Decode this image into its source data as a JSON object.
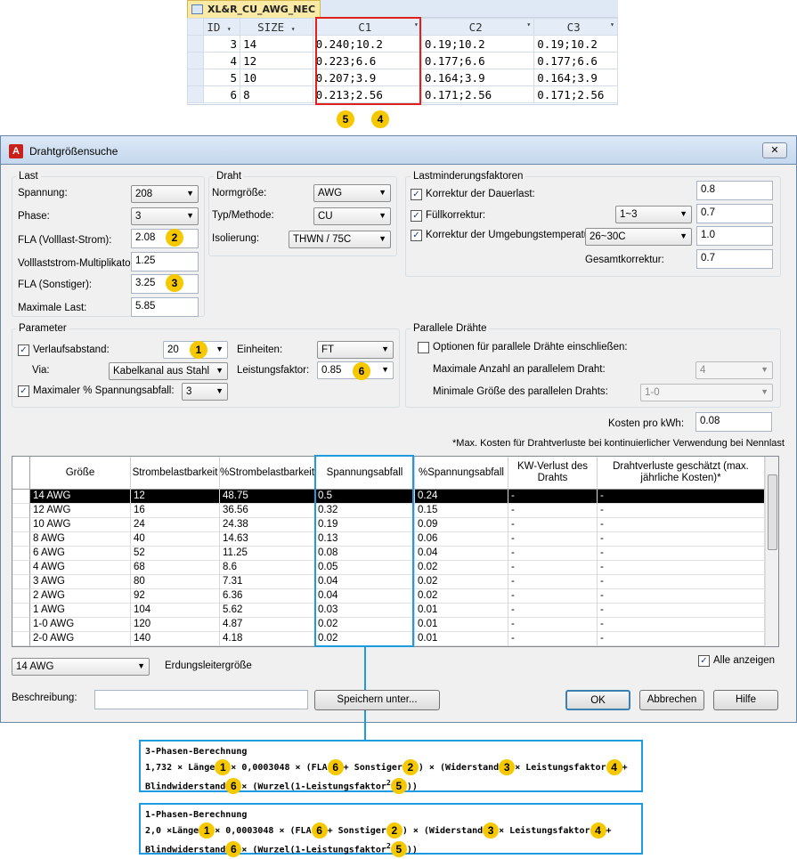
{
  "table": {
    "tab_title": "XL&R_CU_AWG_NEC",
    "columns": [
      "ID",
      "SIZE",
      "C1",
      "C2",
      "C3"
    ],
    "rows": [
      {
        "id": "3",
        "size": "14",
        "c1": "0.240;10.2",
        "c2": "0.19;10.2",
        "c3": "0.19;10.2"
      },
      {
        "id": "4",
        "size": "12",
        "c1": "0.223;6.6",
        "c2": "0.177;6.6",
        "c3": "0.177;6.6"
      },
      {
        "id": "5",
        "size": "10",
        "c1": "0.207;3.9",
        "c2": "0.164;3.9",
        "c3": "0.164;3.9"
      },
      {
        "id": "6",
        "size": "8",
        "c1": "0.213;2.56",
        "c2": "0.171;2.56",
        "c3": "0.171;2.56"
      }
    ],
    "badges": [
      "5",
      "4"
    ]
  },
  "dialog": {
    "title": "Drahtgrößensuche",
    "close": "✕",
    "last": {
      "group": "Last",
      "spannung_label": "Spannung:",
      "spannung": "208",
      "phase_label": "Phase:",
      "phase": "3",
      "fla_label": "FLA (Volllast-Strom):",
      "fla": "2.08",
      "mult_label": "Volllaststrom-Multiplikator:",
      "mult": "1.25",
      "fla_s_label": "FLA (Sonstiger):",
      "fla_s": "3.25",
      "max_label": "Maximale Last:",
      "max": "5.85"
    },
    "draht": {
      "group": "Draht",
      "norm_label": "Normgröße:",
      "norm": "AWG",
      "typ_label": "Typ/Methode:",
      "typ": "CU",
      "iso_label": "Isolierung:",
      "iso": "THWN / 75C"
    },
    "lm": {
      "group": "Lastminderungsfaktoren",
      "dauer_label": "Korrektur der Dauerlast:",
      "dauer": "0.8",
      "full_label": "Füllkorrektur:",
      "full_sel": "1~3",
      "full": "0.7",
      "umg_label": "Korrektur der Umgebungstemperatur:",
      "umg_sel": "26~30C",
      "umg": "1.0",
      "ges_label": "Gesamtkorrektur:",
      "ges": "0.7"
    },
    "param": {
      "group": "Parameter",
      "verl_label": "Verlaufsabstand:",
      "verl": "20",
      "via_label": "Via:",
      "via": "Kabelkanal aus Stahl",
      "max_label": "Maximaler % Spannungsabfall:",
      "max": "3",
      "einh_label": "Einheiten:",
      "einh": "FT",
      "lf_label": "Leistungsfaktor:",
      "lf": "0.85"
    },
    "par": {
      "group": "Parallele Drähte",
      "opt_label": "Optionen für parallele Drähte einschließen:",
      "maxanz_label": "Maximale Anzahl an parallelem Draht:",
      "maxanz": "4",
      "mingr_label": "Minimale Größe des parallelen Drahts:",
      "mingr": "1-0"
    },
    "kosten_label": "Kosten pro kWh:",
    "kosten": "0.08",
    "note": "*Max. Kosten für Drahtverluste bei kontinuierlicher Verwendung bei Nennlast",
    "grid": {
      "headers": [
        "Größe",
        "Strombelastbarkeit",
        "%Strombelastbarkeit",
        "Spannungsabfall",
        "%Spannungsabfall",
        "KW-Verlust des Drahts",
        "Drahtverluste geschätzt (max. jährliche Kosten)*"
      ],
      "rows": [
        [
          "14 AWG",
          "12",
          "48.75",
          "0.5",
          "0.24",
          "-",
          "-"
        ],
        [
          "12 AWG",
          "16",
          "36.56",
          "0.32",
          "0.15",
          "-",
          "-"
        ],
        [
          "10 AWG",
          "24",
          "24.38",
          "0.19",
          "0.09",
          "-",
          "-"
        ],
        [
          "8 AWG",
          "40",
          "14.63",
          "0.13",
          "0.06",
          "-",
          "-"
        ],
        [
          "6 AWG",
          "52",
          "11.25",
          "0.08",
          "0.04",
          "-",
          "-"
        ],
        [
          "4 AWG",
          "68",
          "8.6",
          "0.05",
          "0.02",
          "-",
          "-"
        ],
        [
          "3 AWG",
          "80",
          "7.31",
          "0.04",
          "0.02",
          "-",
          "-"
        ],
        [
          "2 AWG",
          "92",
          "6.36",
          "0.04",
          "0.02",
          "-",
          "-"
        ],
        [
          "1 AWG",
          "104",
          "5.62",
          "0.03",
          "0.01",
          "-",
          "-"
        ],
        [
          "1-0 AWG",
          "120",
          "4.87",
          "0.02",
          "0.01",
          "-",
          "-"
        ],
        [
          "2-0 AWG",
          "140",
          "4.18",
          "0.02",
          "0.01",
          "-",
          "-"
        ]
      ]
    },
    "erd": "14 AWG",
    "erd_label": "Erdungsleitergröße",
    "alle_label": "Alle anzeigen",
    "beschr_label": "Beschreibung:",
    "beschr": "",
    "speichern": "Speichern unter...",
    "ok": "OK",
    "abbrechen": "Abbrechen",
    "hilfe": "Hilfe"
  },
  "formula3": {
    "title": "3-Phasen-Berechnung",
    "l1a": "1,732 × Länge",
    "l1b": "× 0,0003048 × (FLA",
    "l1c": "+ Sonstiger",
    "l1d": ") × (Widerstand",
    "l1e": "× Leistungsfaktor",
    "l1f": "+",
    "l2a": "Blindwiderstand",
    "l2b": "× (Wurzel(1-Leistungsfaktor",
    "l2c": "2",
    "l2d": "))"
  },
  "formula1": {
    "title": "1-Phasen-Berechnung",
    "l1a": "2,0 ×Länge",
    "l1b": "× 0,0003048 × (FLA",
    "l1c": "+ Sonstiger",
    "l1d": ") × (Widerstand",
    "l1e": "× Leistungsfaktor",
    "l1f": "+",
    "l2a": "Blindwiderstand",
    "l2b": "× (Wurzel(1-Leistungsfaktor",
    "l2c": "2",
    "l2d": "))"
  },
  "badge_nums": {
    "b1": "1",
    "b2": "2",
    "b3": "3",
    "b4": "4",
    "b5": "5",
    "b6": "6"
  },
  "sort_arrow": "▾"
}
